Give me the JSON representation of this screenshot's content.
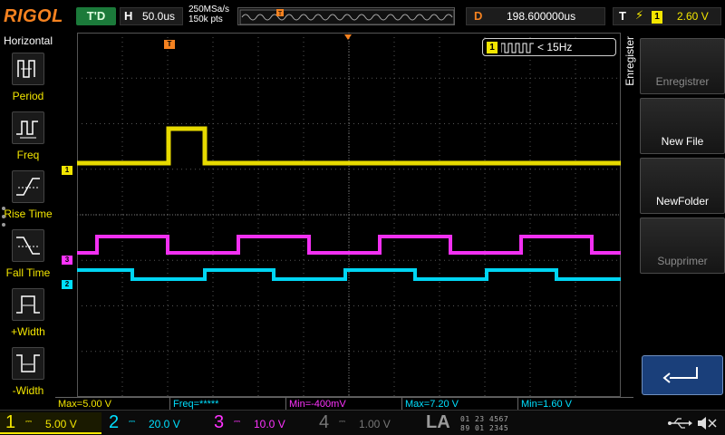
{
  "topbar": {
    "logo": "RIGOL",
    "trigger_status": "T'D",
    "horizontal_key": "H",
    "timebase": "50.0us",
    "sample_rate": "250MSa/s",
    "memory_depth": "150k pts",
    "delay_key": "D",
    "delay": "198.600000us",
    "trigger_key": "T",
    "trigger_source": "1",
    "trigger_level": "2.60 V"
  },
  "left_menu": {
    "title": "Horizontal",
    "items": [
      {
        "label": "Period",
        "icon": "period-icon"
      },
      {
        "label": "Freq",
        "icon": "frequency-icon"
      },
      {
        "label": "Rise Time",
        "icon": "rise-time-icon"
      },
      {
        "label": "Fall Time",
        "icon": "fall-time-icon"
      },
      {
        "label": "+Width",
        "icon": "positive-width-icon"
      },
      {
        "label": "-Width",
        "icon": "negative-width-icon"
      }
    ]
  },
  "screen": {
    "freq_counter_channel": "1",
    "freq_counter_value": "< 15Hz",
    "channel_markers": [
      "1",
      "3",
      "2"
    ]
  },
  "right_menu": {
    "title": "Enregister",
    "buttons": [
      {
        "label": "Enregistrer",
        "enabled": false
      },
      {
        "label": "New File",
        "enabled": true
      },
      {
        "label": "NewFolder",
        "enabled": true
      },
      {
        "label": "Supprimer",
        "enabled": false
      }
    ],
    "return_icon": "return-arrow-icon"
  },
  "measurements": [
    {
      "text": "Max=5.00 V",
      "color": "#f3e600"
    },
    {
      "text": "Freq=*****",
      "color": "#00e0ff"
    },
    {
      "text": "Min=-400mV",
      "color": "#ff33ff"
    },
    {
      "text": "Max=7.20 V",
      "color": "#00e0ff"
    },
    {
      "text": "Min=1.60 V",
      "color": "#00e0ff"
    }
  ],
  "channels": [
    {
      "num": "1",
      "scale": "5.00 V",
      "color": "#f3e600",
      "active": true
    },
    {
      "num": "2",
      "scale": "20.0 V",
      "color": "#00e0ff",
      "active": true
    },
    {
      "num": "3",
      "scale": "10.0 V",
      "color": "#ff33ff",
      "active": true
    },
    {
      "num": "4",
      "scale": "1.00 V",
      "color": "#777777",
      "active": false
    }
  ],
  "logic_analyzer": {
    "label": "LA",
    "row1": "01 23 4567",
    "row2": "89 01 2345"
  },
  "colors": {
    "ch1": "#f3e600",
    "ch2": "#00e0ff",
    "ch3": "#ff33ff",
    "accent": "#f58220"
  }
}
